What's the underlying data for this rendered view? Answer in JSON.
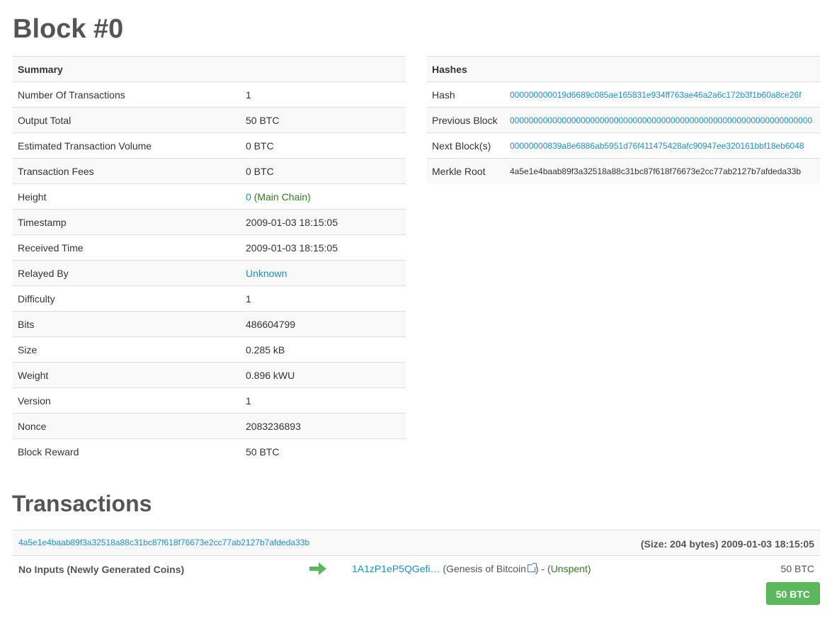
{
  "page": {
    "title": "Block #0"
  },
  "summary": {
    "header": "Summary",
    "rows": [
      {
        "label": "Number Of Transactions",
        "value": "1"
      },
      {
        "label": "Output Total",
        "value": "50 BTC"
      },
      {
        "label": "Estimated Transaction Volume",
        "value": "0 BTC"
      },
      {
        "label": "Transaction Fees",
        "value": "0 BTC"
      },
      {
        "label": "Height",
        "value": "0",
        "value_suffix": " (Main Chain)"
      },
      {
        "label": "Timestamp",
        "value": "2009-01-03 18:15:05"
      },
      {
        "label": "Received Time",
        "value": "2009-01-03 18:15:05"
      },
      {
        "label": "Relayed By",
        "value": "Unknown"
      },
      {
        "label": "Difficulty",
        "value": "1"
      },
      {
        "label": "Bits",
        "value": "486604799"
      },
      {
        "label": "Size",
        "value": "0.285 kB"
      },
      {
        "label": "Weight",
        "value": "0.896 kWU"
      },
      {
        "label": "Version",
        "value": "1"
      },
      {
        "label": "Nonce",
        "value": "2083236893"
      },
      {
        "label": "Block Reward",
        "value": "50 BTC"
      }
    ]
  },
  "hashes": {
    "header": "Hashes",
    "rows": [
      {
        "label": "Hash",
        "value": "000000000019d6689c085ae165831e934ff763ae46a2a6c172b3f1b60a8ce26f"
      },
      {
        "label": "Previous Block",
        "value": "0000000000000000000000000000000000000000000000000000000000000000"
      },
      {
        "label": "Next Block(s)",
        "value": "00000000839a8e6886ab5951d76f411475428afc90947ee320161bbf18eb6048"
      },
      {
        "label": "Merkle Root",
        "value": "4a5e1e4baab89f3a32518a88c31bc87f618f76673e2cc77ab2127b7afdeda33b"
      }
    ]
  },
  "transactions": {
    "title": "Transactions",
    "items": [
      {
        "hash": "4a5e1e4baab89f3a32518a88c31bc87f618f76673e2cc77ab2127b7afdeda33b",
        "meta": "(Size: 204 bytes) 2009-01-03 18:15:05",
        "inputs": "No Inputs (Newly Generated Coins)",
        "output_address": "1A1zP1eP5QGefi…",
        "output_tag_open": " (",
        "output_tag": "Genesis of Bitcoin",
        "output_tag_close": ") - (",
        "output_status": "Unspent",
        "output_status_close": ")",
        "output_amount": "50 BTC",
        "total": "50 BTC"
      }
    ]
  },
  "colors": {
    "link": "#1a8fc9",
    "total_badge": "#5cb85c",
    "arrow": "#5cb85c",
    "main_chain": "#2e7d1e"
  },
  "icons": {
    "arrow": "arrow-right-icon",
    "external": "external-link-icon"
  }
}
